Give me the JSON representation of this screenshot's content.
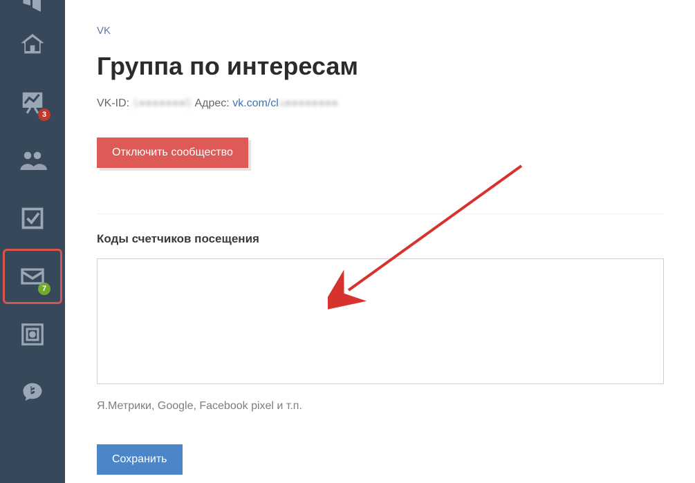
{
  "sidebar": {
    "items": [
      {
        "name": "megaphone",
        "badge": null
      },
      {
        "name": "home",
        "badge": null
      },
      {
        "name": "chart",
        "badge": "3",
        "badge_color": "red"
      },
      {
        "name": "people",
        "badge": null
      },
      {
        "name": "checkbox",
        "badge": null
      },
      {
        "name": "mail",
        "badge": "7",
        "badge_color": "green",
        "selected": true
      },
      {
        "name": "safe",
        "badge": null
      },
      {
        "name": "senler",
        "badge": null
      }
    ]
  },
  "breadcrumb": "VK",
  "page_title": "Группа по интересам",
  "meta": {
    "vkid_label": "VK-ID:",
    "vkid_value": "1●●●●●●●5",
    "addr_label": "Адрес:",
    "addr_link_text": "vk.com/cl",
    "addr_link_blur": "u●●●●●●●●"
  },
  "buttons": {
    "disconnect": "Отключить сообщество",
    "save": "Сохранить"
  },
  "counters": {
    "label": "Коды счетчиков посещения",
    "value": "",
    "hint": "Я.Метрики, Google, Facebook pixel и т.п."
  },
  "colors": {
    "sidebar_bg": "#38485b",
    "accent_link": "#3c72b5",
    "danger": "#dd5a57",
    "primary": "#4b87c8",
    "badge_red": "#c0392b",
    "badge_green": "#72a92e",
    "select_border": "#d9534f",
    "arrow": "#d7322d"
  }
}
